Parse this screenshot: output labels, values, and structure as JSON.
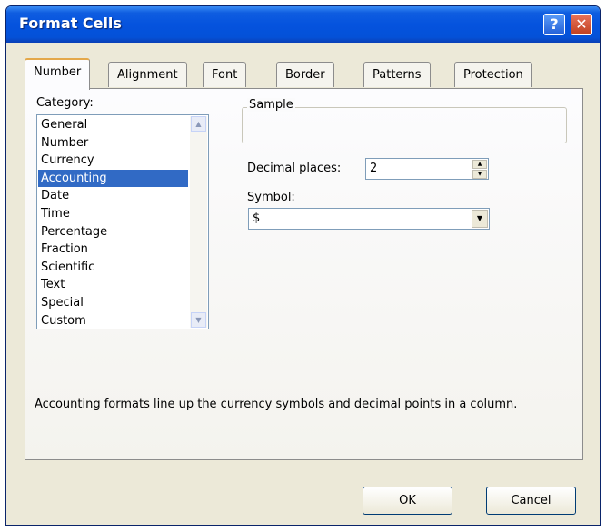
{
  "window": {
    "title": "Format Cells",
    "help_label": "?",
    "close_label": "✕"
  },
  "tabs": [
    {
      "label": "Number",
      "active": true
    },
    {
      "label": "Alignment",
      "active": false
    },
    {
      "label": "Font",
      "active": false
    },
    {
      "label": "Border",
      "active": false
    },
    {
      "label": "Patterns",
      "active": false
    },
    {
      "label": "Protection",
      "active": false
    }
  ],
  "category": {
    "label": "Category:",
    "items": [
      "General",
      "Number",
      "Currency",
      "Accounting",
      "Date",
      "Time",
      "Percentage",
      "Fraction",
      "Scientific",
      "Text",
      "Special",
      "Custom"
    ],
    "selected": "Accounting"
  },
  "sample": {
    "label": "Sample",
    "value": ""
  },
  "decimal_places": {
    "label": "Decimal places:",
    "value": "2"
  },
  "symbol": {
    "label": "Symbol:",
    "value": "$"
  },
  "description": "Accounting formats line up the currency symbols and decimal points in a column.",
  "buttons": {
    "ok": "OK",
    "cancel": "Cancel"
  },
  "colors": {
    "titlebar": "#0553de",
    "selection": "#316ac5",
    "dialog_bg": "#ece9d8"
  }
}
